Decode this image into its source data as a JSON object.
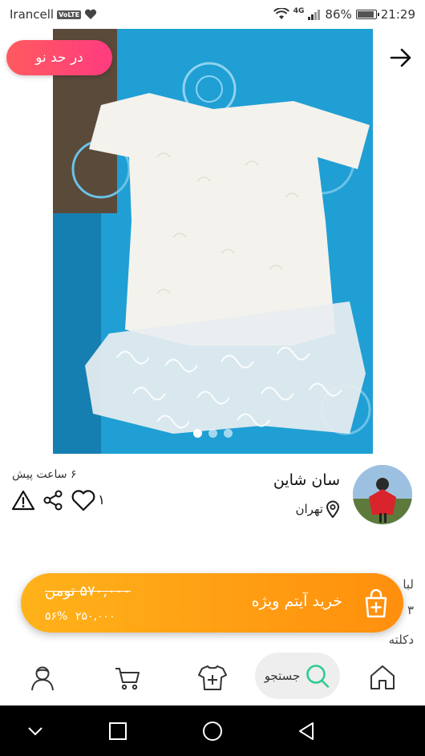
{
  "status_bar": {
    "carrier": "Irancell",
    "volte": "VoLTE",
    "network": "4G",
    "battery": "86%",
    "battery_level": 0.86,
    "time": "21:29"
  },
  "listing": {
    "condition_badge": "در حد نو",
    "image_count": 3,
    "active_image": 1
  },
  "seller": {
    "name": "سان شاین",
    "city": "تهران",
    "posted_time": "۶ ساعت پیش",
    "like_count": "۱"
  },
  "description_peek": {
    "line1": "لبا",
    "line2": "۳",
    "line3": "دکلته"
  },
  "buy_banner": {
    "label": "خرید آیتم ویژه",
    "old_price": "۵۷۰,۰۰۰ تومن",
    "new_price": "۲۵۰,۰۰۰",
    "discount": "۵۶%"
  },
  "bottom_nav": {
    "search_label": "جستجو",
    "items": [
      "home-icon",
      "search-icon",
      "add-item-icon",
      "cart-icon",
      "profile-icon"
    ]
  },
  "colors": {
    "accent_orange": "#ff9f12",
    "badge_red": "#ff4d6d",
    "search_green": "#2ecc8f"
  }
}
